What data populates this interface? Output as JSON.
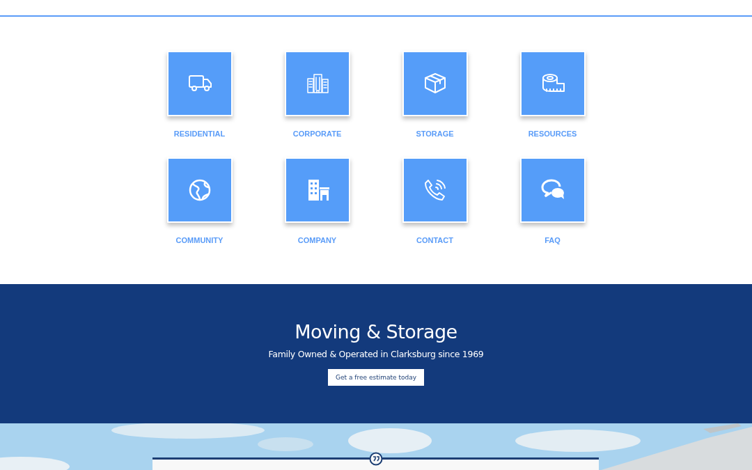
{
  "services": [
    {
      "label": "RESIDENTIAL"
    },
    {
      "label": "CORPORATE"
    },
    {
      "label": "STORAGE"
    },
    {
      "label": "RESOURCES"
    },
    {
      "label": "COMMUNITY"
    },
    {
      "label": "COMPANY"
    },
    {
      "label": "CONTACT"
    },
    {
      "label": "FAQ"
    }
  ],
  "hero": {
    "title": "Moving & Storage",
    "subtitle": "Family Owned & Operated in Clarksburg since 1969",
    "button": "Get a free estimate today"
  }
}
